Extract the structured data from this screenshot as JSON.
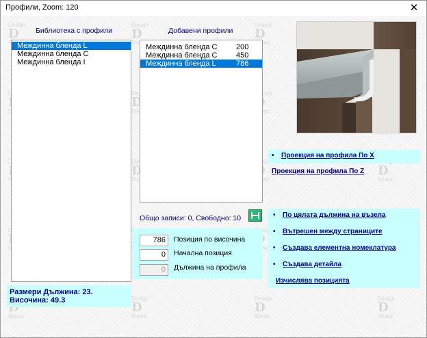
{
  "window": {
    "title": "Профили, Zoom:  120",
    "close_glyph": "✕"
  },
  "library": {
    "heading": "Библиотека с профили",
    "items": [
      {
        "label": "Междинна бленда L",
        "selected": true
      },
      {
        "label": "Междинна бленда C",
        "selected": false
      },
      {
        "label": "Междинна бленда I",
        "selected": false
      }
    ]
  },
  "added": {
    "heading": "Добавени профили",
    "items": [
      {
        "label": "Междинна бленда C",
        "value": "200",
        "selected": false
      },
      {
        "label": "Междинна бленда C",
        "value": "450",
        "selected": false
      },
      {
        "label": "Междинна бленда L",
        "value": "786",
        "selected": true
      }
    ]
  },
  "projections": {
    "x": "Проекция на профила По X",
    "z": "Проекция на профила По Z"
  },
  "options": {
    "full_length": "По цялата дължина на възела",
    "inner": "Вътрешен между страниците",
    "nomenclature": "Създава елементна номеклатура",
    "create_part": "Създава детайла",
    "calc_position": "Изчислява позицията"
  },
  "bullet": "•",
  "status": "Общо записи: 0, Свободно: 10",
  "fields": {
    "height_position": {
      "value": "786",
      "label": "Позиция по височина"
    },
    "start_position": {
      "value": "0",
      "label": "Начална позиция"
    },
    "profile_length": {
      "value": "0",
      "label": "Дължина на профила"
    }
  },
  "dimensions": {
    "length": "Размери Дължина: 23.",
    "height": "Височина: 49.3"
  },
  "watermark": {
    "letter": "D",
    "word1": "Design",
    "word2": "Sintez"
  },
  "colors": {
    "accent_cyan": "#c8ffff",
    "link_navy": "#00008b",
    "selection": "#0078d7"
  }
}
